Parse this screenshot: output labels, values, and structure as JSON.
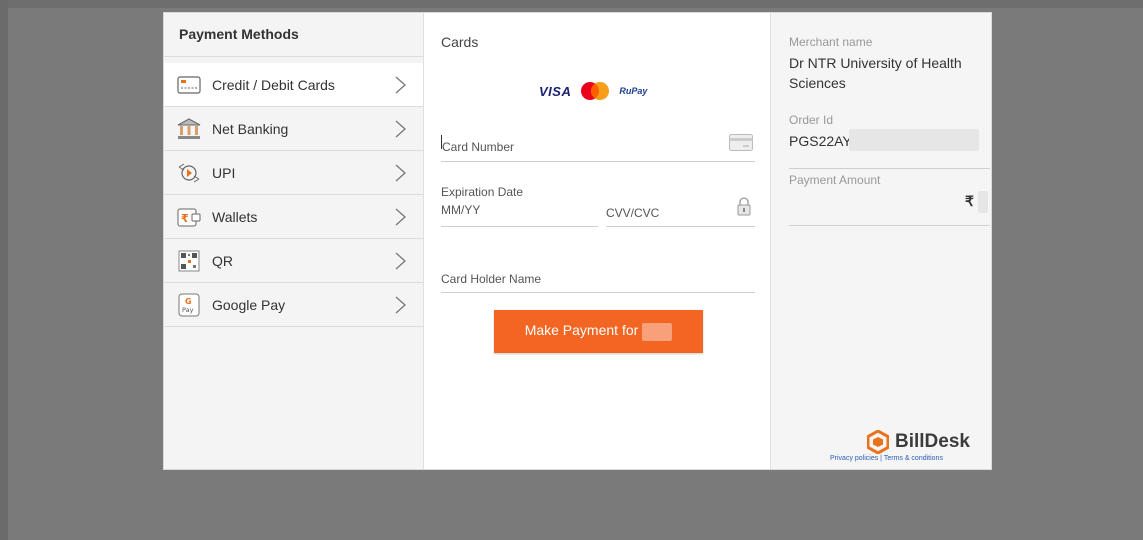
{
  "payment_methods": {
    "title": "Payment Methods",
    "items": [
      {
        "label": "Credit / Debit Cards",
        "icon": "card-icon"
      },
      {
        "label": "Net Banking",
        "icon": "bank-icon"
      },
      {
        "label": "UPI",
        "icon": "upi-icon"
      },
      {
        "label": "Wallets",
        "icon": "wallet-icon"
      },
      {
        "label": "QR",
        "icon": "qr-icon"
      },
      {
        "label": "Google Pay",
        "icon": "google-pay-icon"
      }
    ]
  },
  "cards_form": {
    "title": "Cards",
    "brands": [
      "VISA",
      "RuPay"
    ],
    "card_number_placeholder": "Card Number",
    "expiration_label": "Expiration Date",
    "expiry_placeholder": "MM/YY",
    "cvv_placeholder": "CVV/CVC",
    "holder_placeholder": "Card Holder Name",
    "pay_button": "Make Payment for"
  },
  "summary": {
    "merchant_label": "Merchant name",
    "merchant_value": "Dr NTR University of Health Sciences",
    "order_label": "Order Id",
    "order_value": "PGS22AY",
    "amount_label": "Payment Amount",
    "currency_symbol": "₹"
  },
  "footer": {
    "brand": "BillDesk",
    "links": "Privacy policies | Terms & conditions"
  },
  "colors": {
    "accent": "#f26522",
    "billdesk_orange": "#e8731c"
  }
}
